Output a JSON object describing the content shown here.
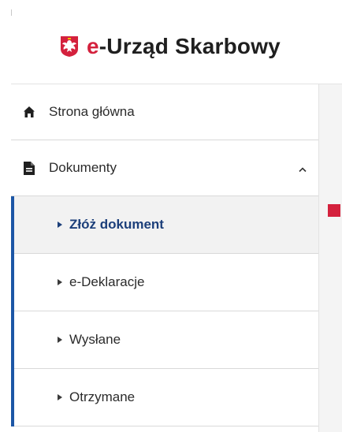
{
  "brand": {
    "name_prefix": "e",
    "name_rest": "-Urząd Skarbowy",
    "emblem_icon": "polish-eagle-emblem-icon",
    "accent_color": "#d4213d"
  },
  "menu": {
    "items": [
      {
        "label": "Strona główna",
        "icon": "home-icon"
      },
      {
        "label": "Dokumenty",
        "icon": "document-icon",
        "expanded": true,
        "chevron_icon": "chevron-up-icon"
      }
    ],
    "submenu": [
      {
        "label": "Złóż dokument",
        "active": true
      },
      {
        "label": "e-Deklaracje",
        "active": false
      },
      {
        "label": "Wysłane",
        "active": false
      },
      {
        "label": "Otrzymane",
        "active": false
      }
    ],
    "active_color": "#1c56a6"
  }
}
